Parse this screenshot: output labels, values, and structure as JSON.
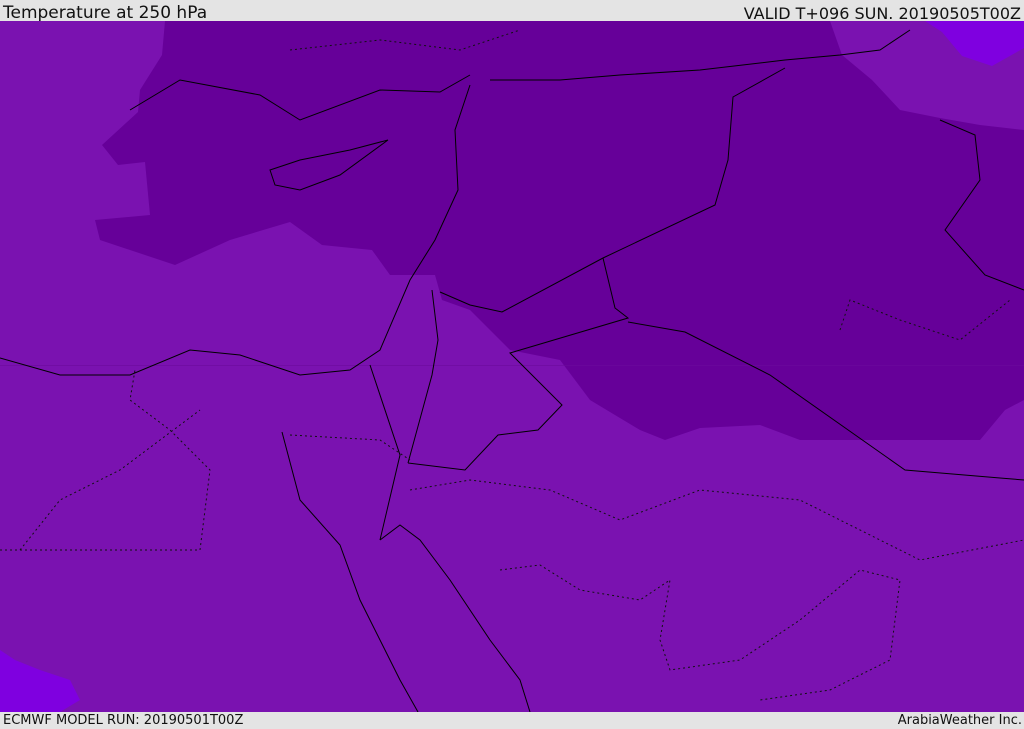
{
  "header": {
    "title": "Temperature at 250 hPa",
    "valid": "VALID T+096 SUN. 20190505T00Z"
  },
  "footer": {
    "model_run": "ECMWF MODEL RUN: 20190501T00Z",
    "credit": "ArabiaWeather Inc."
  },
  "map": {
    "variable": "Temperature",
    "level": "250 hPa",
    "colors": {
      "base": "#7a12b0",
      "cold": "#660099",
      "warm": "#7f00e0",
      "border": "#000000"
    }
  }
}
